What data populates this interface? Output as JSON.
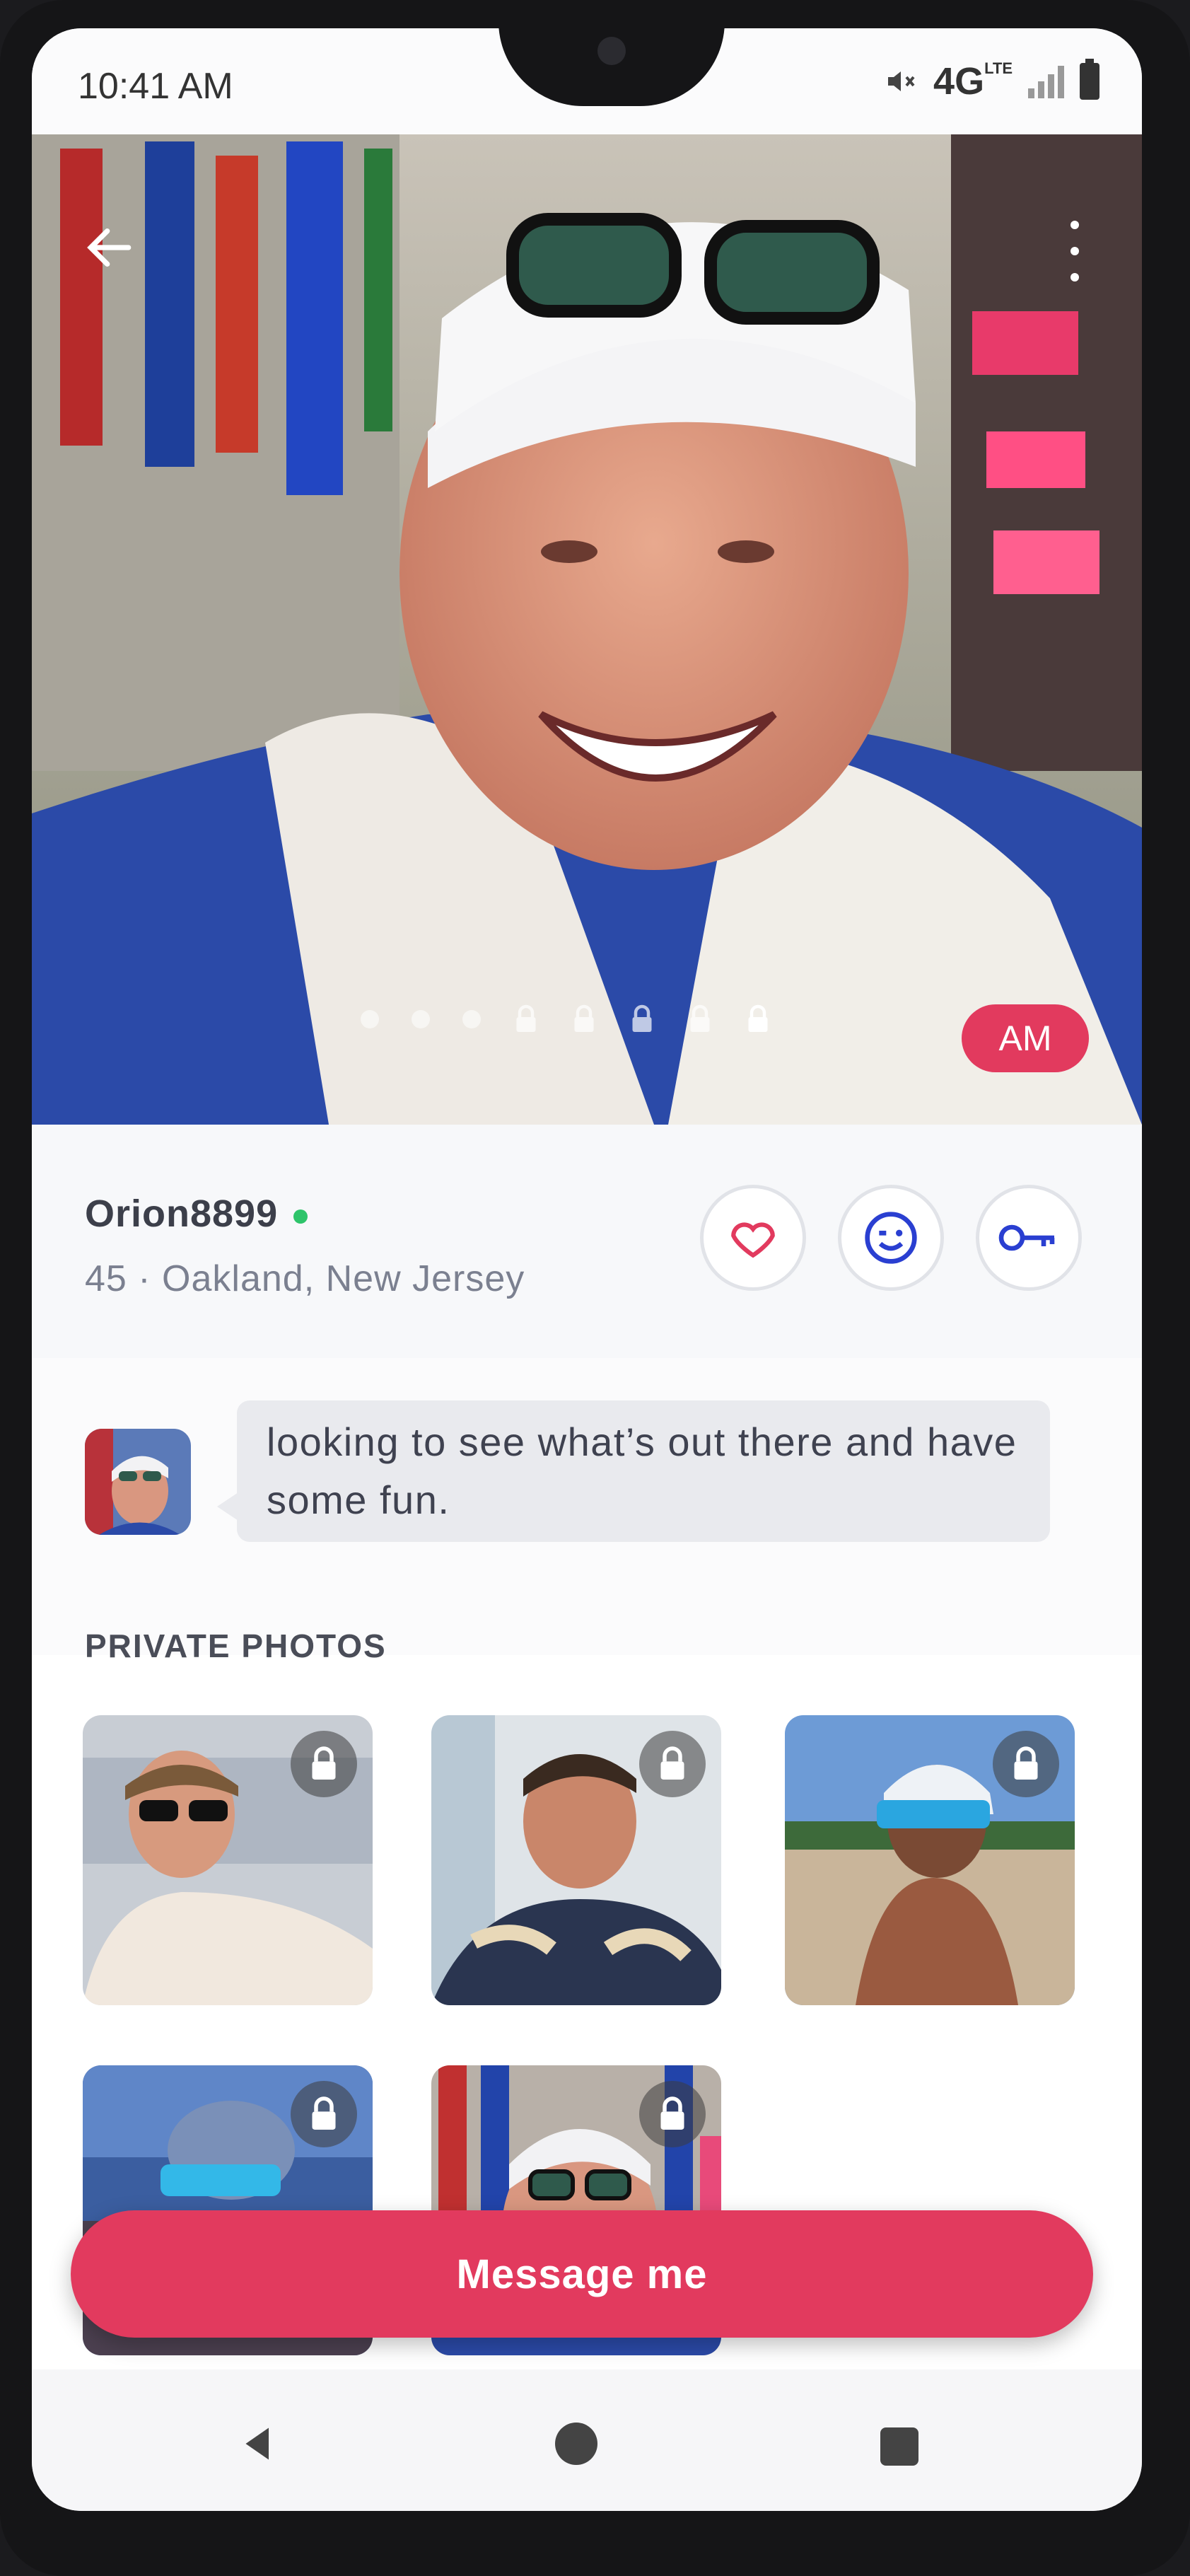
{
  "status_bar": {
    "time": "10:41 AM",
    "network": "4G",
    "network_sup": "LTE"
  },
  "hero": {
    "photo_count": 8,
    "unlocked_photos": 3,
    "badge": "AM"
  },
  "profile": {
    "username": "Orion8899",
    "online": true,
    "age_location": "45 · Oakland, New Jersey",
    "actions": [
      "heart-icon",
      "wink-icon",
      "key-icon"
    ]
  },
  "about": {
    "message": "looking to see what’s out there and have some fun."
  },
  "private_photos": {
    "title": "PRIVATE PHOTOS",
    "count": 5
  },
  "message_button": {
    "label": "Message me"
  },
  "colors": {
    "accent": "#e23a5e",
    "online": "#2ec46a",
    "action_icon_heart": "#e23a5e",
    "action_icon_blue": "#2a3fd1"
  }
}
